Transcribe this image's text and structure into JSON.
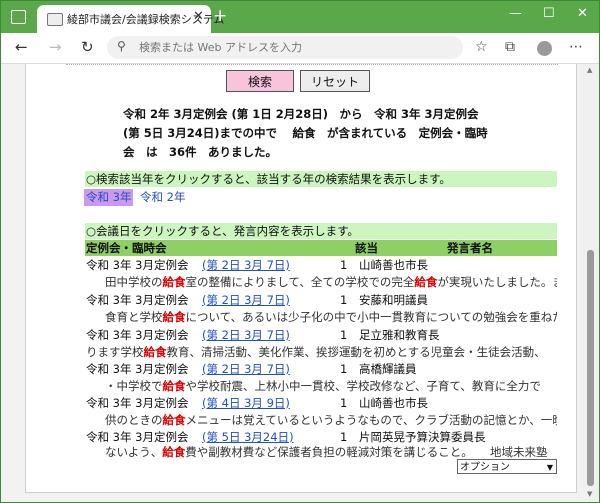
{
  "browser": {
    "tab_title": "綾部市議会/会議録検索システム",
    "tab_close": "✕",
    "new_tab": "+",
    "min": "—",
    "max": "☐",
    "close": "✕",
    "address_placeholder": "検索または Web アドレスを入力"
  },
  "buttons": {
    "search": "検索",
    "reset": "リセット"
  },
  "summary": "令和 2年 3月定例会 (第 1日 2月28日)　から　令和 3年 3月定例会 (第 5日 3月24日)までの中で　 給食　が含まれている　定例会・臨時会　は　36件　ありました。",
  "year_info": "○検索該当年をクリックすると、該当する年の検索結果を表示します。",
  "years": [
    "令和 3年",
    "令和 2年"
  ],
  "date_info": "○会議日をクリックすると、発言内容を表示します。",
  "table": {
    "headers": {
      "session": "定例会・臨時会",
      "hits": "該当",
      "speaker": "発言者名"
    },
    "keyword": "給食",
    "rows": [
      {
        "session": "令和 3年 3月定例会",
        "date": "(第 2日 3月 7日)",
        "hits": "1",
        "speaker": "山崎善也市長",
        "snippet": {
          "pre": "田中学校の",
          "mid": "室の整備によりまして、全ての学校での完全",
          "post": "が実現いたしました。ま"
        }
      },
      {
        "session": "令和 3年 3月定例会",
        "date": "(第 2日 3月 7日)",
        "hits": "1",
        "speaker": "安藤和明議員",
        "snippet": {
          "pre": "食育と学校",
          "mid": "について、あるいは少子化の中で小中一貫教育についての勉強会を重ねた",
          "post": ""
        }
      },
      {
        "session": "令和 3年 3月定例会",
        "date": "(第 2日 3月 7日)",
        "hits": "1",
        "speaker": "足立雅和教育長",
        "snippet": {
          "pre": "ります学校",
          "mid": "教育、清掃活動、美化作業、挨拶運動を初めとする児童会・生徒会活動、",
          "post": ""
        }
      },
      {
        "session": "令和 3年 3月定例会",
        "date": "(第 2日 3月 7日)",
        "hits": "1",
        "speaker": "高橋輝議員",
        "snippet": {
          "pre": "・中学校で",
          "mid": "や学校耐震、上林小中一貫校、学校改修など、子育て、教育に全力で",
          "post": ""
        }
      },
      {
        "session": "令和 3年 3月定例会",
        "date": "(第 4日 3月 9日)",
        "hits": "1",
        "speaker": "山崎善也市長",
        "snippet": {
          "pre": "供のときの",
          "mid": "メニューは覚えているというようなもので、クラブ活動の記憶とか、一晩",
          "post": ""
        }
      },
      {
        "session": "令和 3年 3月定例会",
        "date": "(第 5日 3月24日)",
        "hits": "1",
        "speaker": "片岡英晃予算決算委員長",
        "snippet": {
          "pre": "ないよう、",
          "mid": "費や副教材費など保護者負担の軽減対策を講じること。　　地域未来塾",
          "post": ""
        }
      }
    ]
  },
  "option_select": "オプション"
}
